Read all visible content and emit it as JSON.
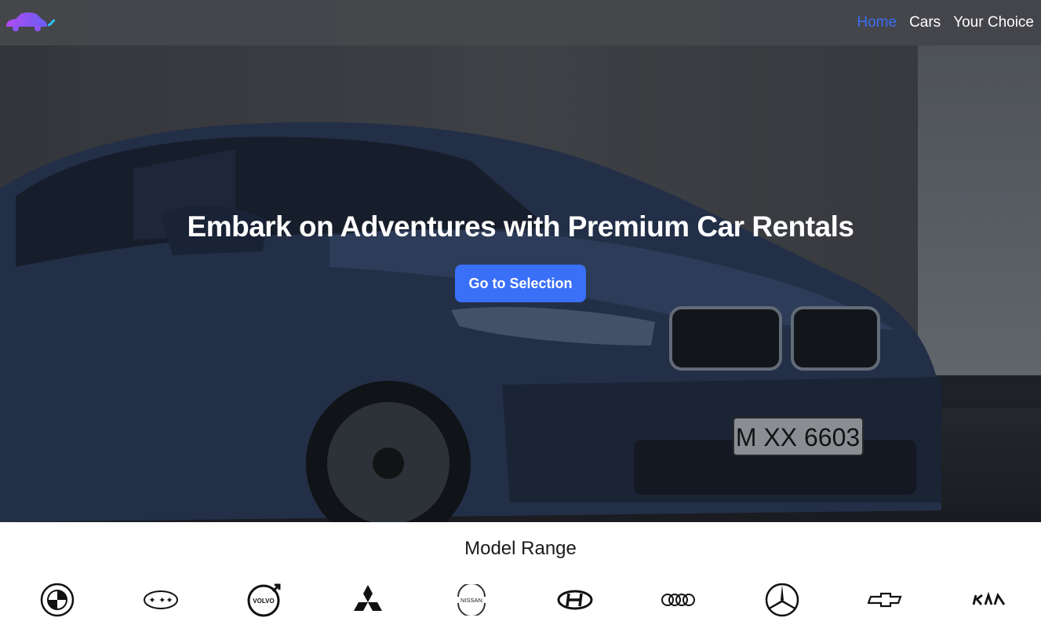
{
  "nav": {
    "logo_icon": "car-logo-icon",
    "links": [
      {
        "label": "Home",
        "active": true
      },
      {
        "label": "Cars",
        "active": false
      },
      {
        "label": "Your Choice",
        "active": false
      }
    ]
  },
  "hero": {
    "title": "Embark on Adventures with Premium Car Rentals",
    "cta_label": "Go to Selection",
    "plate_text": "M XX 6603"
  },
  "models": {
    "title": "Model Range",
    "brands": [
      {
        "icon": "bmw-icon"
      },
      {
        "icon": "subaru-icon"
      },
      {
        "icon": "volvo-icon",
        "label": "VOLVO"
      },
      {
        "icon": "mitsubishi-icon"
      },
      {
        "icon": "nissan-icon",
        "label": "NISSAN"
      },
      {
        "icon": "hyundai-icon"
      },
      {
        "icon": "audi-icon"
      },
      {
        "icon": "mercedes-icon"
      },
      {
        "icon": "chevrolet-icon"
      },
      {
        "icon": "kia-icon",
        "label": "KIA"
      }
    ]
  },
  "colors": {
    "accent": "#3a6ff7",
    "nav_active": "#3b6ef5",
    "navbar_bg": "#46484c"
  }
}
